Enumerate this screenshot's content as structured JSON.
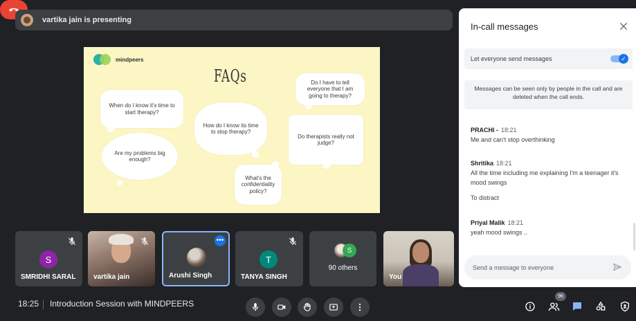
{
  "presenter": {
    "text": "vartika jain is presenting"
  },
  "slide": {
    "logo_text": "mindpeers",
    "title": "FAQs",
    "bubbles": [
      "When do I know it's time to start therapy?",
      "How do I know its time to stop therapy?",
      "Do I have to tell everyone that I am going to therapy?",
      "Are my problems big enough?",
      "Do therapists really not judge?",
      "What's the confidentiality policy?"
    ]
  },
  "participants": [
    {
      "name": "SMRIDHI SARAL",
      "initial": "S",
      "color": "#8e24aa",
      "muted": true
    },
    {
      "name": "vartika jain",
      "muted": true
    },
    {
      "name": "Arushi Singh",
      "muted": false
    },
    {
      "name": "TANYA SINGH",
      "initial": "T",
      "color": "#00897b",
      "muted": true
    },
    {
      "label": "90 others",
      "badge": "S"
    },
    {
      "name": "You"
    }
  ],
  "bottom_bar": {
    "time": "18:25",
    "meeting_title": "Introduction Session with MINDPEERS",
    "people_count": "96"
  },
  "chat": {
    "title": "In-call messages",
    "toggle_label": "Let everyone send messages",
    "toggle_on": true,
    "notice": "Messages can be seen only by people in the call and are deleted when the call ends.",
    "messages": [
      {
        "sender": "PRACHI -",
        "time": "18:21",
        "lines": [
          "Me and can't stop overthinking"
        ]
      },
      {
        "sender": "Shritika",
        "time": "18:21",
        "lines": [
          "All the time including me explaining I'm a teenager it's mood swings",
          "To distract"
        ]
      },
      {
        "sender": "Priyal Malik",
        "time": "18:21",
        "lines": [
          "yeah mood swings .."
        ]
      }
    ],
    "input_placeholder": "Send a message to everyone"
  },
  "colors": {
    "background": "#202124",
    "tile": "#3c4043",
    "accent": "#1a73e8",
    "end_call": "#ea4335",
    "slide_bg": "#fbf6c4"
  }
}
